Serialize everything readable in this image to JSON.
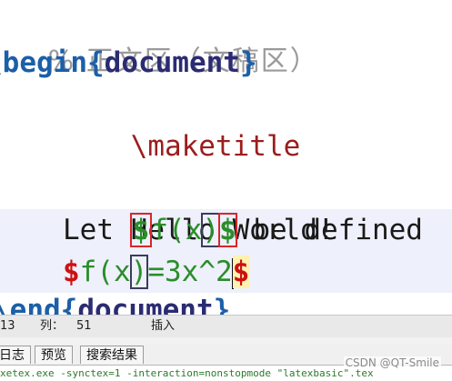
{
  "editor": {
    "comment": "% 正文区（文稿区）",
    "begin_cmd": "\\begin",
    "begin_arg": "document",
    "maketitle": "\\maketitle",
    "hello": "Hello World!",
    "let_prefix": "Let ",
    "dollar": "$",
    "math_fx": "f(x",
    "paren_close": ")",
    "let_suffix": " be defined",
    "eq_math_a": "f(x",
    "eq_math_b": "=3x^2",
    "end_cmd": "\\end",
    "end_arg": "document"
  },
  "statusbar": {
    "line_label": "13",
    "col_label": "列：",
    "col_value": "51",
    "mode": "插入"
  },
  "tabs": [
    "日志",
    "预览",
    "搜索结果"
  ],
  "log_text": "xetex.exe -synctex=1 -interaction=nonstopmode \"latexbasic\".tex",
  "watermark": "CSDN @QT-Smile",
  "colors": {
    "keyword": "#1b5fa8",
    "command": "#9b1d1d",
    "math": "#2a8d2a",
    "dollar": "#cc1111",
    "highlight_box": "#d8262b"
  }
}
